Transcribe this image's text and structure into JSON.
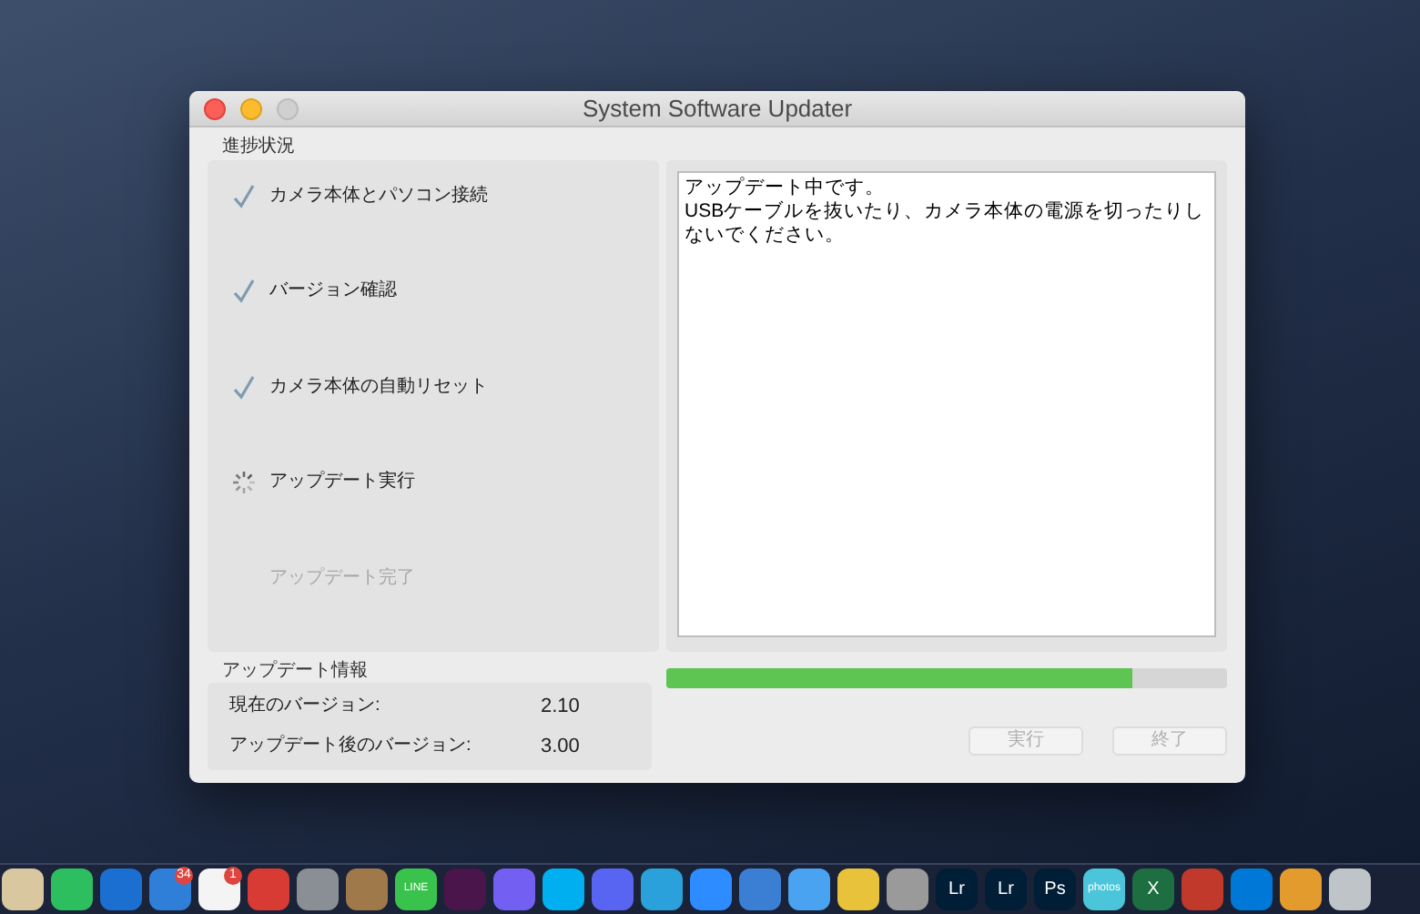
{
  "window": {
    "title": "System Software Updater"
  },
  "progress_section": {
    "label": "進捗状況",
    "steps": [
      {
        "label": "カメラ本体とパソコン接続",
        "kind": "done"
      },
      {
        "label": "バージョン確認",
        "kind": "done"
      },
      {
        "label": "カメラ本体の自動リセット",
        "kind": "done"
      },
      {
        "label": "アップデート実行",
        "kind": "running"
      },
      {
        "label": "アップデート完了",
        "kind": "pending"
      }
    ]
  },
  "message": {
    "lines": [
      "アップデート中です。",
      "USBケーブルを抜いたり、カメラ本体の電源を切ったりしないでください。"
    ]
  },
  "update_info": {
    "label": "アップデート情報",
    "rows": [
      {
        "label": "現在のバージョン:",
        "value": "2.10"
      },
      {
        "label": "アップデート後のバージョン:",
        "value": "3.00"
      }
    ]
  },
  "progress_bar": {
    "level": 0.83
  },
  "buttons": [
    {
      "label": "実行",
      "disabled": true
    },
    {
      "label": "終了",
      "disabled": true
    }
  ],
  "dock": [
    {
      "color": "#d9c7a0"
    },
    {
      "color": "#2dbe60"
    },
    {
      "color": "#1a6fd1"
    },
    {
      "color": "#2f7fd8",
      "badge": "34"
    },
    {
      "color": "#f4f4f4",
      "badge": "1"
    },
    {
      "color": "#d83a34"
    },
    {
      "color": "#8a8f96"
    },
    {
      "color": "#a0794b"
    },
    {
      "color": "#3ac34c",
      "label": "LINE"
    },
    {
      "color": "#4a154b"
    },
    {
      "color": "#7360f2"
    },
    {
      "color": "#00aff0"
    },
    {
      "color": "#5865f2"
    },
    {
      "color": "#2aa1da"
    },
    {
      "color": "#2d8cff"
    },
    {
      "color": "#3b7fd4"
    },
    {
      "color": "#4aa3f0"
    },
    {
      "color": "#e7c23a"
    },
    {
      "color": "#9a9a9a"
    },
    {
      "color": "#001e36",
      "label": "Lr"
    },
    {
      "color": "#001e36",
      "label": "Lr"
    },
    {
      "color": "#001e36",
      "label": "Ps"
    },
    {
      "color": "#4ac5d9",
      "label": "photos"
    },
    {
      "color": "#1d6f42",
      "label": "X"
    },
    {
      "color": "#c0392b"
    },
    {
      "color": "#0078d7"
    },
    {
      "color": "#e39b2e"
    },
    {
      "color": "#bfc4c9"
    }
  ]
}
